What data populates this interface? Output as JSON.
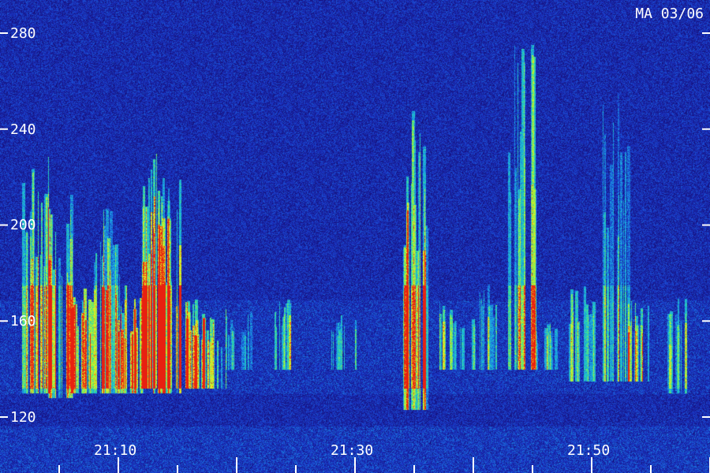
{
  "chart_data": {
    "type": "heatmap",
    "title": "MA 03/06",
    "x_ticks_labels": [
      "21:10",
      "21:30",
      "21:50"
    ],
    "x_range": [
      "21:02",
      "22:00"
    ],
    "y_ticks": [
      120,
      160,
      200,
      240,
      280
    ],
    "y_range": [
      115,
      295
    ],
    "grid": false,
    "colormap": [
      "#16107a",
      "#1a37c8",
      "#1aa0e8",
      "#26d8b0",
      "#9ff03a",
      "#f0f020",
      "#e82010"
    ],
    "bursts": [
      {
        "t": "21:03",
        "f_low": 130,
        "f_high": 230,
        "intensity": 0.9
      },
      {
        "t": "21:05",
        "f_low": 128,
        "f_high": 215,
        "intensity": 0.8
      },
      {
        "t": "21:07",
        "f_low": 130,
        "f_high": 175,
        "intensity": 0.75
      },
      {
        "t": "21:09",
        "f_low": 130,
        "f_high": 210,
        "intensity": 0.8
      },
      {
        "t": "21:11",
        "f_low": 130,
        "f_high": 175,
        "intensity": 0.85
      },
      {
        "t": "21:13",
        "f_low": 132,
        "f_high": 235,
        "intensity": 0.95
      },
      {
        "t": "21:14",
        "f_low": 130,
        "f_high": 220,
        "intensity": 1.0
      },
      {
        "t": "21:16",
        "f_low": 132,
        "f_high": 170,
        "intensity": 0.7
      },
      {
        "t": "21:18",
        "f_low": 132,
        "f_high": 165,
        "intensity": 0.6
      },
      {
        "t": "21:20",
        "f_low": 140,
        "f_high": 165,
        "intensity": 0.35
      },
      {
        "t": "21:24",
        "f_low": 140,
        "f_high": 170,
        "intensity": 0.45
      },
      {
        "t": "21:29",
        "f_low": 140,
        "f_high": 165,
        "intensity": 0.35
      },
      {
        "t": "21:35",
        "f_low": 123,
        "f_high": 250,
        "intensity": 0.85
      },
      {
        "t": "21:38",
        "f_low": 140,
        "f_high": 170,
        "intensity": 0.4
      },
      {
        "t": "21:41",
        "f_low": 140,
        "f_high": 175,
        "intensity": 0.45
      },
      {
        "t": "21:44",
        "f_low": 140,
        "f_high": 280,
        "intensity": 0.7
      },
      {
        "t": "21:46",
        "f_low": 140,
        "f_high": 160,
        "intensity": 0.35
      },
      {
        "t": "21:49",
        "f_low": 135,
        "f_high": 175,
        "intensity": 0.45
      },
      {
        "t": "21:52",
        "f_low": 135,
        "f_high": 255,
        "intensity": 0.55
      },
      {
        "t": "21:54",
        "f_low": 135,
        "f_high": 170,
        "intensity": 0.5
      },
      {
        "t": "21:57",
        "f_low": 130,
        "f_high": 170,
        "intensity": 0.35
      }
    ]
  }
}
